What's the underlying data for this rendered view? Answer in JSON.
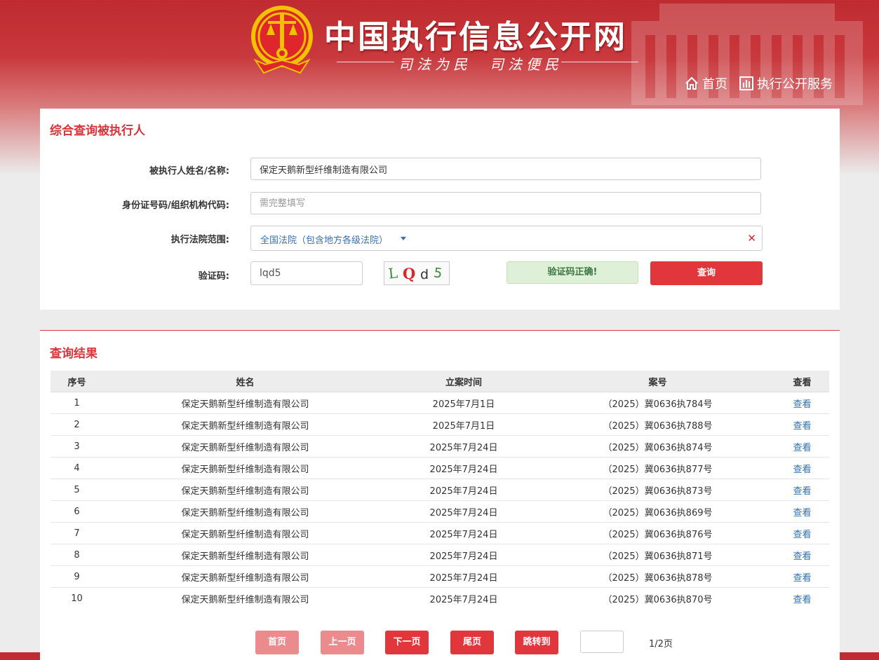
{
  "header": {
    "site_title": "中国执行信息公开网",
    "slogan": "司法为民　司法便民",
    "nav": [
      {
        "label": "首页",
        "icon": "home-icon"
      },
      {
        "label": "执行公开服务",
        "icon": "bar-chart-icon"
      }
    ]
  },
  "search": {
    "title": "综合查询被执行人",
    "name_label": "被执行人姓名/名称:",
    "name_value": "保定天鹅新型纤维制造有限公司",
    "id_label": "身份证号码/组织机构代码:",
    "id_placeholder": "需完整填写",
    "court_label": "执行法院范围:",
    "court_value": "全国法院（包含地方各级法院）",
    "captcha_label": "验证码:",
    "captcha_value": "lqd5",
    "captcha_image_text": "LQd5",
    "captcha_status": "验证码正确!",
    "search_button": "查询"
  },
  "results": {
    "title": "查询结果",
    "columns": [
      "序号",
      "姓名",
      "立案时间",
      "案号",
      "查看"
    ],
    "view_label": "查看",
    "rows": [
      {
        "no": "1",
        "name": "保定天鹅新型纤维制造有限公司",
        "date": "2025年7月1日",
        "case_no": "（2025）冀0636执784号"
      },
      {
        "no": "2",
        "name": "保定天鹅新型纤维制造有限公司",
        "date": "2025年7月1日",
        "case_no": "（2025）冀0636执788号"
      },
      {
        "no": "3",
        "name": "保定天鹅新型纤维制造有限公司",
        "date": "2025年7月24日",
        "case_no": "（2025）冀0636执874号"
      },
      {
        "no": "4",
        "name": "保定天鹅新型纤维制造有限公司",
        "date": "2025年7月24日",
        "case_no": "（2025）冀0636执877号"
      },
      {
        "no": "5",
        "name": "保定天鹅新型纤维制造有限公司",
        "date": "2025年7月24日",
        "case_no": "（2025）冀0636执873号"
      },
      {
        "no": "6",
        "name": "保定天鹅新型纤维制造有限公司",
        "date": "2025年7月24日",
        "case_no": "（2025）冀0636执869号"
      },
      {
        "no": "7",
        "name": "保定天鹅新型纤维制造有限公司",
        "date": "2025年7月24日",
        "case_no": "（2025）冀0636执876号"
      },
      {
        "no": "8",
        "name": "保定天鹅新型纤维制造有限公司",
        "date": "2025年7月24日",
        "case_no": "（2025）冀0636执871号"
      },
      {
        "no": "9",
        "name": "保定天鹅新型纤维制造有限公司",
        "date": "2025年7月24日",
        "case_no": "（2025）冀0636执878号"
      },
      {
        "no": "10",
        "name": "保定天鹅新型纤维制造有限公司",
        "date": "2025年7月24日",
        "case_no": "（2025）冀0636执870号"
      }
    ]
  },
  "pager": {
    "first": "首页",
    "prev": "上一页",
    "next": "下一页",
    "last": "尾页",
    "jump": "跳转到",
    "jump_value": "",
    "page_info": "1/2页"
  },
  "colors": {
    "brand_red": "#e0363c",
    "title_red": "#d8343a",
    "link_blue": "#2f6fad",
    "success_green": "#3c763d"
  }
}
